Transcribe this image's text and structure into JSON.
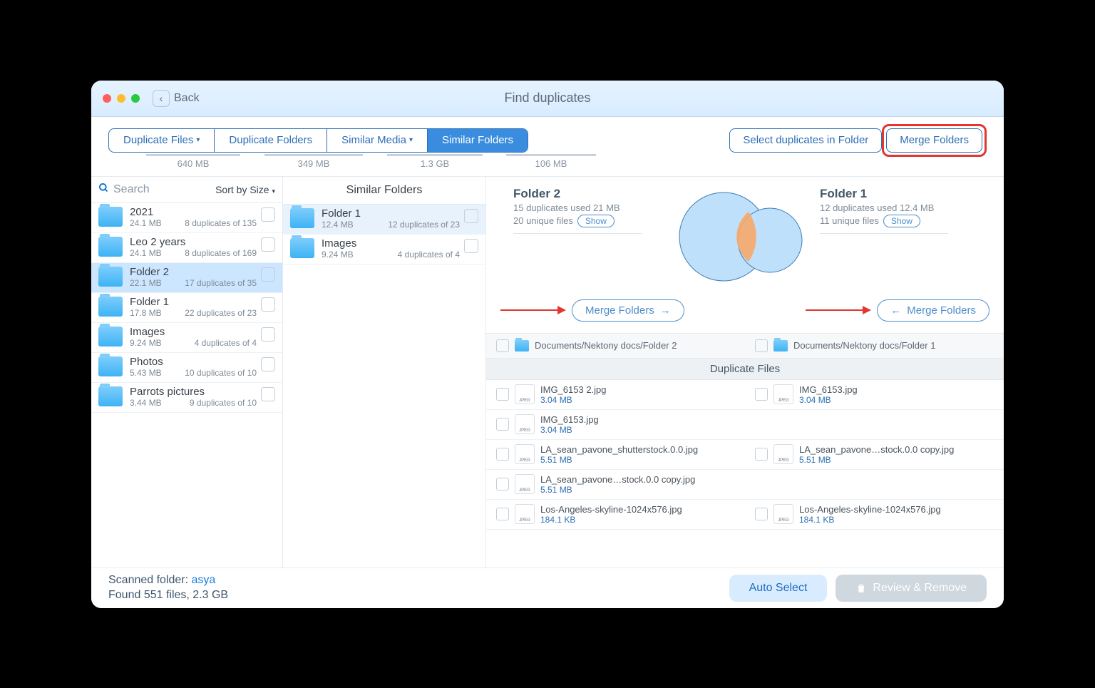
{
  "titlebar": {
    "back": "Back",
    "title": "Find duplicates"
  },
  "segments": [
    {
      "label": "Duplicate Files",
      "caret": true,
      "size": "640 MB"
    },
    {
      "label": "Duplicate Folders",
      "caret": false,
      "size": "349 MB"
    },
    {
      "label": "Similar Media",
      "caret": true,
      "size": "1.3 GB"
    },
    {
      "label": "Similar Folders",
      "caret": false,
      "size": "106 MB"
    }
  ],
  "btn_select_dup": "Select duplicates in Folder",
  "btn_merge": "Merge Folders",
  "search_placeholder": "Search",
  "sort_label": "Sort by Size",
  "folders": [
    {
      "name": "2021",
      "size": "24.1 MB",
      "dup": "8 duplicates of 135"
    },
    {
      "name": "Leo 2 years",
      "size": "24.1 MB",
      "dup": "8 duplicates of 169"
    },
    {
      "name": "Folder 2",
      "size": "22.1 MB",
      "dup": "17 duplicates of 35"
    },
    {
      "name": "Folder 1",
      "size": "17.8 MB",
      "dup": "22 duplicates of 23"
    },
    {
      "name": "Images",
      "size": "9.24 MB",
      "dup": "4 duplicates of 4"
    },
    {
      "name": "Photos",
      "size": "5.43 MB",
      "dup": "10 duplicates of 10"
    },
    {
      "name": "Parrots pictures",
      "size": "3.44 MB",
      "dup": "9 duplicates of 10"
    }
  ],
  "col2_title": "Similar Folders",
  "similar": [
    {
      "name": "Folder 1",
      "size": "12.4 MB",
      "dup": "12 duplicates of 23"
    },
    {
      "name": "Images",
      "size": "9.24 MB",
      "dup": "4 duplicates of 4"
    }
  ],
  "compare": {
    "left": {
      "title": "Folder 2",
      "line1": "15 duplicates used 21 MB",
      "line2": "20 unique files",
      "show": "Show",
      "path": "Documents/Nektony docs/Folder 2"
    },
    "right": {
      "title": "Folder 1",
      "line1": "12 duplicates used 12.4 MB",
      "line2": "11 unique files",
      "show": "Show",
      "path": "Documents/Nektony docs/Folder 1"
    },
    "merge_btn": "Merge Folders",
    "dup_header": "Duplicate Files"
  },
  "files": [
    [
      {
        "name": "IMG_6153 2.jpg",
        "size": "3.04 MB"
      },
      {
        "name": "IMG_6153.jpg",
        "size": "3.04 MB"
      }
    ],
    [
      {
        "name": "IMG_6153.jpg",
        "size": "3.04 MB"
      },
      null
    ],
    [
      {
        "name": "LA_sean_pavone_shutterstock.0.0.jpg",
        "size": "5.51 MB"
      },
      {
        "name": "LA_sean_pavone…stock.0.0 copy.jpg",
        "size": "5.51 MB"
      }
    ],
    [
      {
        "name": "LA_sean_pavone…stock.0.0 copy.jpg",
        "size": "5.51 MB"
      },
      null
    ],
    [
      {
        "name": "Los-Angeles-skyline-1024x576.jpg",
        "size": "184.1 KB"
      },
      {
        "name": "Los-Angeles-skyline-1024x576.jpg",
        "size": "184.1 KB"
      }
    ]
  ],
  "footer": {
    "scanned_label": "Scanned folder: ",
    "scanned_link": "asya",
    "found": "Found 551 files, 2.3 GB",
    "auto": "Auto Select",
    "review": "Review & Remove"
  }
}
